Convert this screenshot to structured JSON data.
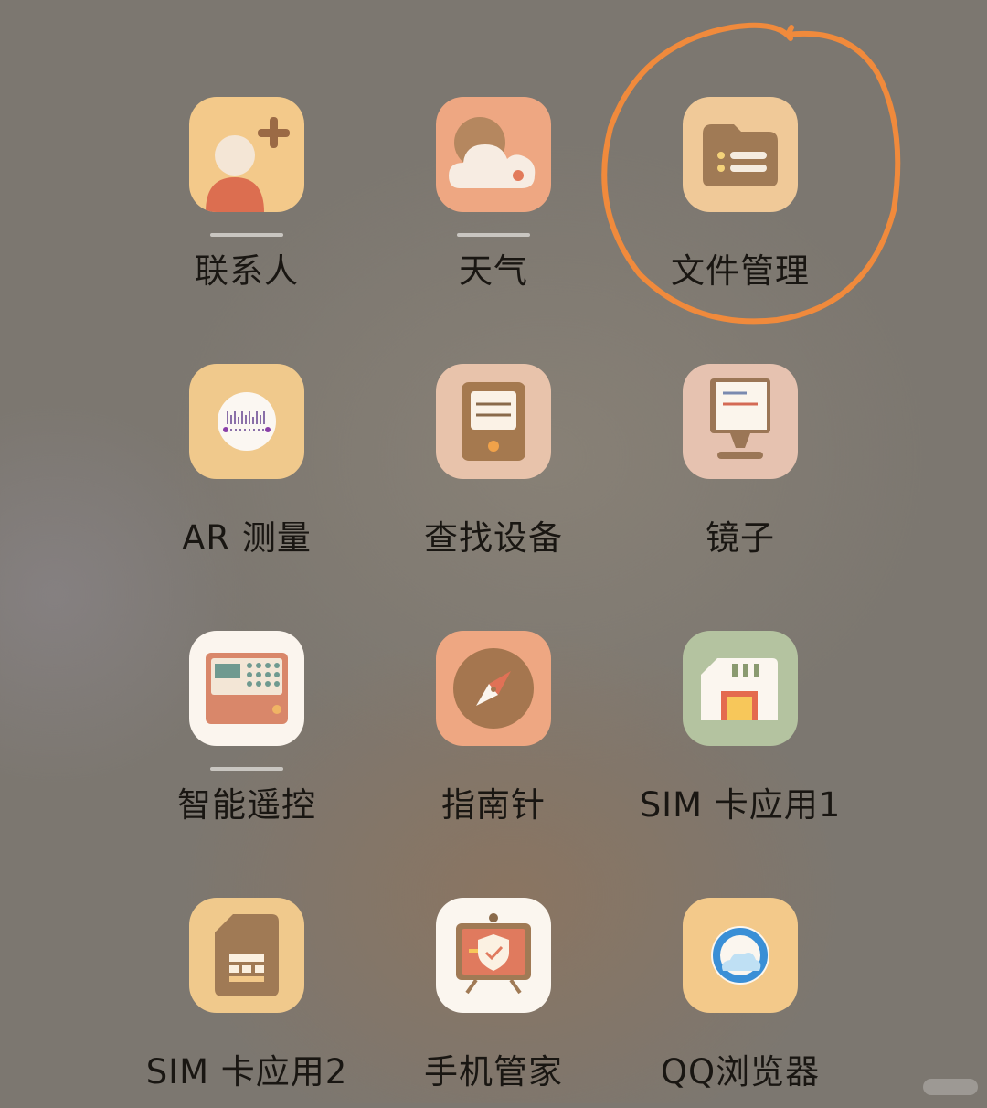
{
  "apps": [
    {
      "label": "联系人",
      "icon": "contacts-icon"
    },
    {
      "label": "天气",
      "icon": "weather-icon"
    },
    {
      "label": "文件管理",
      "icon": "file-manager-icon"
    },
    {
      "label": "AR 测量",
      "icon": "ar-measure-icon"
    },
    {
      "label": "查找设备",
      "icon": "find-device-icon"
    },
    {
      "label": "镜子",
      "icon": "mirror-icon"
    },
    {
      "label": "智能遥控",
      "icon": "smart-remote-icon"
    },
    {
      "label": "指南针",
      "icon": "compass-icon"
    },
    {
      "label": "SIM 卡应用1",
      "icon": "sim-app-1-icon"
    },
    {
      "label": "SIM 卡应用2",
      "icon": "sim-app-2-icon"
    },
    {
      "label": "手机管家",
      "icon": "phone-manager-icon"
    },
    {
      "label": "QQ浏览器",
      "icon": "qq-browser-icon"
    }
  ],
  "colors": {
    "background": "#7c7770",
    "annotation_circle": "#f08a3c",
    "label_text": "#191612"
  }
}
